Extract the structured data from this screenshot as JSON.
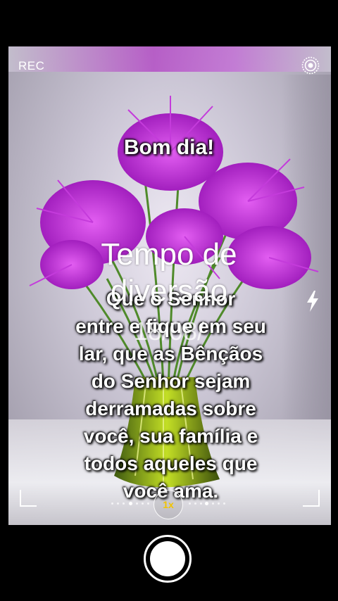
{
  "camera": {
    "rec_label": "REC",
    "zoom_label": "1x",
    "icons": {
      "settings": "settings-ring-icon",
      "flash": "flash-bolt-icon",
      "shutter": "shutter-button"
    }
  },
  "image_text": {
    "greeting": "Bom dia!",
    "message_lines": [
      "Que o Senhor",
      "entre e fique em seu",
      "lar, que as Bênçãos",
      "do Senhor sejam",
      "derramadas sobre",
      "você, sua família e",
      "todos aqueles que",
      "você ama."
    ]
  },
  "overlay": {
    "title_line1": "Tempo de",
    "title_line2": "diversão",
    "date": "18/08/"
  },
  "colors": {
    "flower": "#b72fd0",
    "vase": "#b9d61f",
    "zoom_accent": "#f2c400",
    "background": "#000000"
  }
}
